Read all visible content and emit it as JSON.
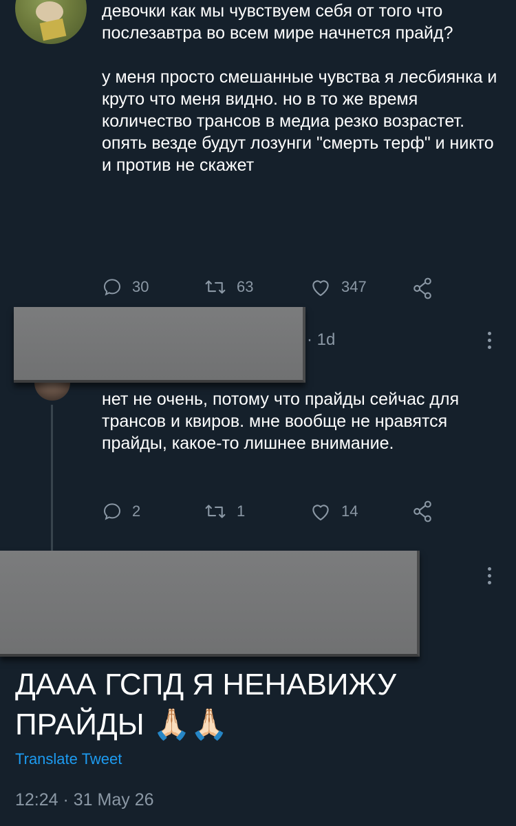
{
  "tweet1": {
    "paragraph1": "девочки как мы чувствуем себя от того что послезавтра во всем мире начнется прайд?",
    "paragraph2": "у меня просто смешанные чувства я лесбиянка и круто что меня видно. но в то же время количество трансов в медиа резко возрастет. опять везде будут лозунги \"смерть терф\" и никто и против не скажет",
    "actions": {
      "replies": "30",
      "retweets": "63",
      "likes": "347"
    }
  },
  "tweet2": {
    "time": "· 1d",
    "text": "нет не очень, потому что прайды сейчас для трансов и квиров. мне вообще не нравятся прайды, какое-то лишнее внимание.",
    "actions": {
      "replies": "2",
      "retweets": "1",
      "likes": "14"
    }
  },
  "tweet3": {
    "text": "ДААА ГСПД Я НЕНАВИЖУ ПРАЙДЫ 🙏🏻🙏🏻",
    "translate_label": "Translate Tweet",
    "timestamp": "12:24 · 31 May 26"
  },
  "colors": {
    "background": "#15202b",
    "text": "#ffffff",
    "secondary": "#8b98a5",
    "link": "#1d9bf0"
  },
  "icons": {
    "reply": "reply-icon",
    "retweet": "retweet-icon",
    "like": "heart-icon",
    "share": "share-icon",
    "more": "more-options-icon"
  }
}
